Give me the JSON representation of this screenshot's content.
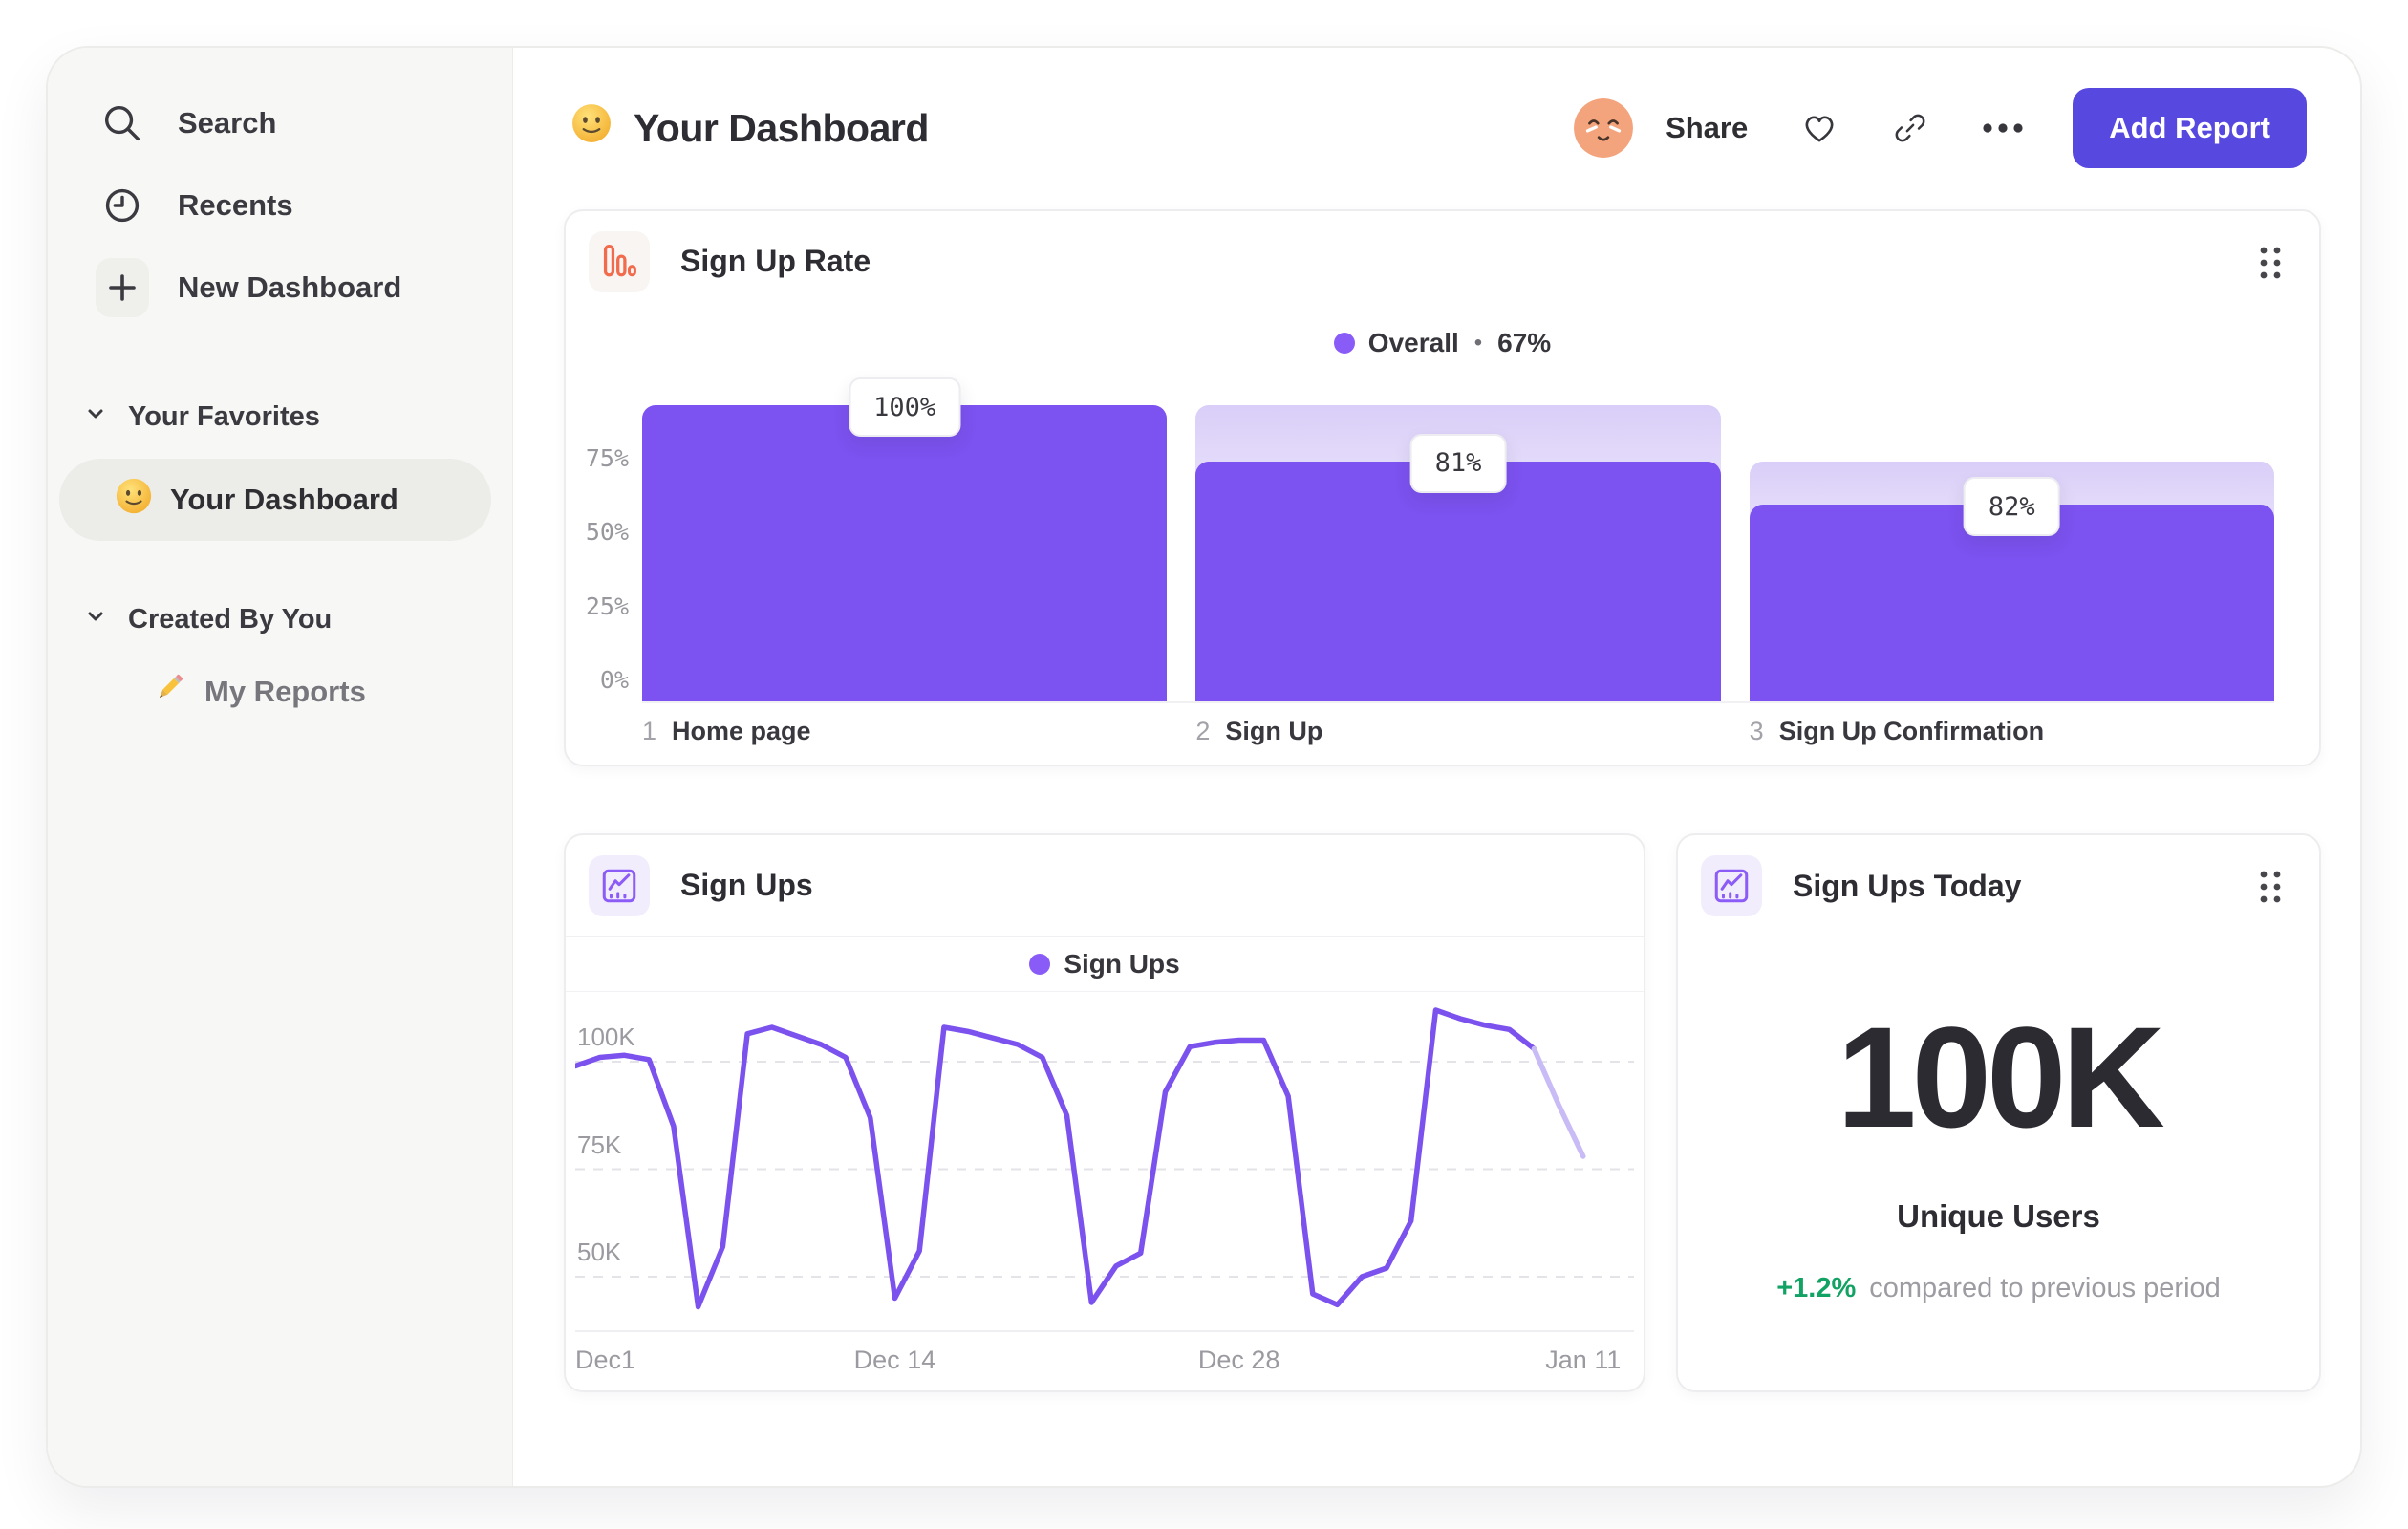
{
  "colors": {
    "accent_purple": "#7C52F0",
    "line_purple": "#7B52EE",
    "line_faded": "#C9BCF6",
    "legend_dot": "#8A5CF7",
    "gradient_top": "#D9CEF8",
    "button_purple": "#5748E0",
    "icon_orange": "#F26B4C",
    "green_positive": "#12A263",
    "icon_tile_lavender": "#F2EDFD"
  },
  "sidebar": {
    "search": "Search",
    "recents": "Recents",
    "new_dashboard": "New Dashboard",
    "favorites_header": "Your Favorites",
    "favorite_item": "Your Dashboard",
    "created_header": "Created By You",
    "created_item": "My Reports"
  },
  "header": {
    "title": "Your Dashboard",
    "share": "Share",
    "add_report": "Add Report"
  },
  "funnel_card": {
    "title": "Sign Up Rate",
    "legend_label": "Overall",
    "legend_bullet": "•",
    "legend_value": "67%"
  },
  "line_card": {
    "title": "Sign Ups",
    "legend_label": "Sign Ups"
  },
  "kpi_card": {
    "title": "Sign Ups Today",
    "value": "100K",
    "label": "Unique Users",
    "delta": "+1.2%",
    "delta_note": "compared to previous period"
  },
  "chart_data": [
    {
      "type": "bar",
      "subtype": "funnel",
      "title": "Sign Up Rate",
      "legend": {
        "label": "Overall",
        "value": "67%"
      },
      "ylim": [
        0,
        100
      ],
      "yticks": [
        {
          "label": "75%",
          "value": 75
        },
        {
          "label": "50%",
          "value": 50
        },
        {
          "label": "25%",
          "value": 25
        },
        {
          "label": "0%",
          "value": 0
        }
      ],
      "steps": [
        {
          "step": "1",
          "label": "Home page",
          "conversion_pct": 100,
          "display": "100%"
        },
        {
          "step": "2",
          "label": "Sign Up",
          "conversion_pct": 81,
          "display": "81%"
        },
        {
          "step": "3",
          "label": "Sign Up Confirmation",
          "conversion_pct": 82,
          "display": "82%"
        }
      ]
    },
    {
      "type": "line",
      "title": "Sign Ups",
      "legend": [
        "Sign Ups"
      ],
      "grid": "dashed-horizontal",
      "yticks": [
        {
          "label": "100K",
          "value": 100
        },
        {
          "label": "75K",
          "value": 75
        },
        {
          "label": "50K",
          "value": 50
        }
      ],
      "xticks": [
        {
          "label": "Dec1",
          "index": 0
        },
        {
          "label": "Dec 14",
          "index": 13
        },
        {
          "label": "Dec 28",
          "index": 27
        },
        {
          "label": "Jan 11",
          "index": 41
        }
      ],
      "values_k": [
        99,
        101,
        101.5,
        100.5,
        85,
        43,
        57,
        106.5,
        108,
        106,
        104,
        101,
        87,
        45,
        56,
        108,
        107,
        105.5,
        104,
        101,
        87.5,
        44,
        52.5,
        55.5,
        93,
        103.5,
        104.5,
        105,
        105,
        92,
        46,
        43.5,
        50,
        52,
        63,
        112,
        110,
        108.5,
        107.5,
        103,
        90,
        78
      ],
      "faded_from_index": 39
    }
  ]
}
